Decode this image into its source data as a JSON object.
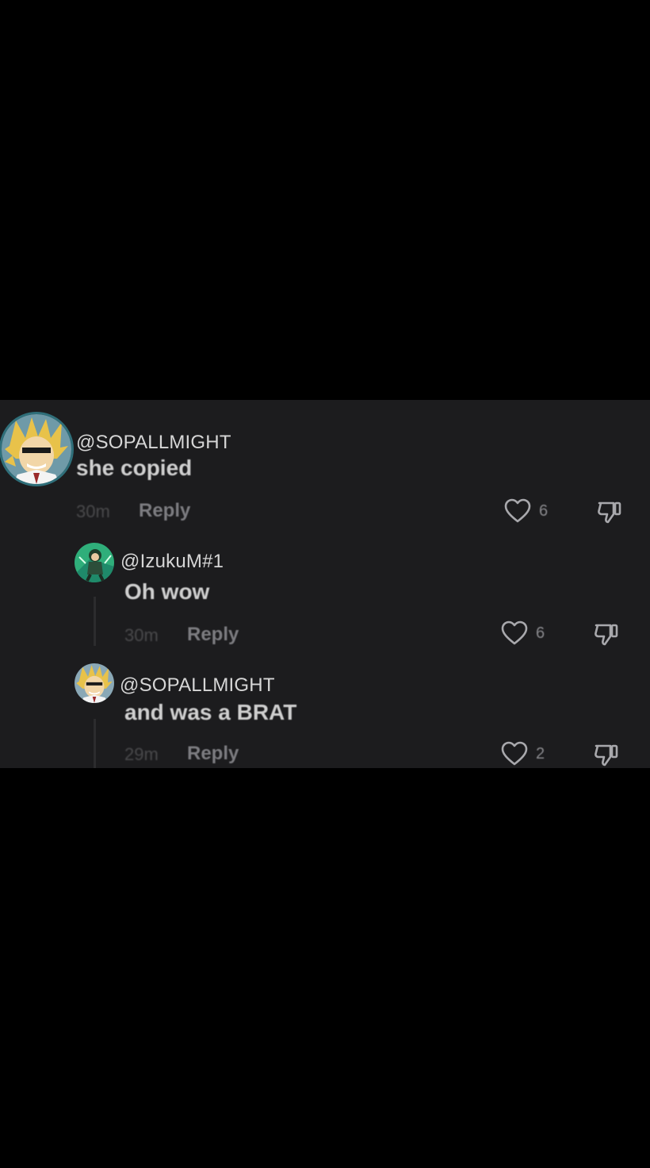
{
  "comments": [
    {
      "username": "@SOPALLMIGHT",
      "text": "she copied",
      "time": "30m",
      "reply_label": "Reply",
      "likes": "6",
      "avatar_icon": "all-might-avatar"
    },
    {
      "username": "@IzukuM#1",
      "text": "Oh wow",
      "time": "30m",
      "reply_label": "Reply",
      "likes": "6",
      "avatar_icon": "izuku-avatar"
    },
    {
      "username": "@SOPALLMIGHT",
      "text": "and was a BRAT",
      "time": "29m",
      "reply_label": "Reply",
      "likes": "2",
      "avatar_icon": "all-might-avatar"
    }
  ],
  "colors": {
    "panel_bg": "#1c1c1e",
    "page_bg": "#000000",
    "text": "#cfcfcf",
    "muted": "#7c7c80"
  }
}
